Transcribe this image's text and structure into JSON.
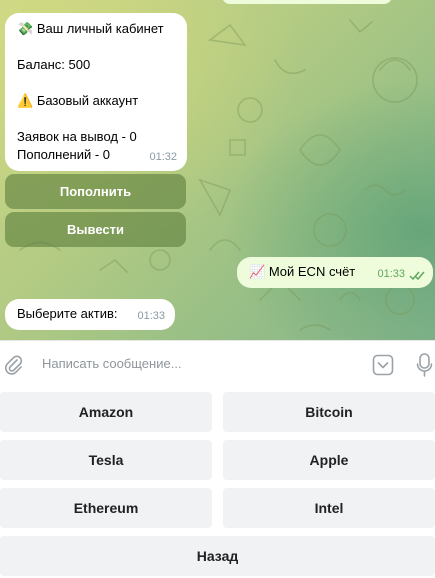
{
  "messages": {
    "cabinet": {
      "emoji": "💸",
      "title": "Ваш личный кабинет",
      "balance": "Баланс: 500",
      "warning_emoji": "⚠️",
      "account_type": "Базовый аккаунт",
      "withdraw_requests": "Заявок на вывод - 0",
      "deposits": "Пополнений - 0",
      "time": "01:32"
    },
    "ecn_account": {
      "emoji": "📈",
      "text": "Мой ECN счёт",
      "time": "01:33"
    },
    "choose_asset": {
      "text": "Выберите актив:",
      "time": "01:33"
    }
  },
  "inline_keyboard": {
    "deposit_label": "Пополнить",
    "withdraw_label": "Вывести"
  },
  "composer": {
    "placeholder": "Написать сообщение..."
  },
  "reply_keyboard": {
    "rows": [
      [
        "Amazon",
        "Bitcoin"
      ],
      [
        "Tesla",
        "Apple"
      ],
      [
        "Ethereum",
        "Intel"
      ]
    ],
    "back_label": "Назад"
  },
  "icons": {
    "attach": "paperclip-icon",
    "keyboard_toggle": "chevron-down-box-icon",
    "voice": "microphone-icon",
    "read_receipt": "double-check-icon"
  },
  "colors": {
    "incoming_bubble": "#ffffff",
    "outgoing_bubble": "#eefcdc",
    "inline_button": "#5e803e",
    "reply_button": "#f0f2f4",
    "read_check": "#5ea85e"
  }
}
